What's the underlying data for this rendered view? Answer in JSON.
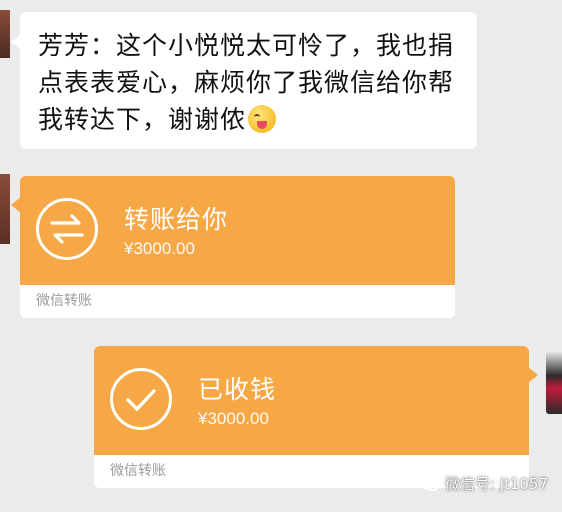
{
  "message": {
    "text": "芳芳：这个小悦悦太可怜了，我也捐点表表爱心，麻烦你了我微信给你帮我转达下，谢谢侬",
    "emoji_icon": "winking-tongue-emoji-icon"
  },
  "transfer_received": {
    "title": "转账给你",
    "amount": "¥3000.00",
    "footer": "微信转账",
    "icon": "transfer-arrows-icon",
    "color": "#f6a846"
  },
  "transfer_sent": {
    "title": "已收钱",
    "amount": "¥3000.00",
    "footer": "微信转账",
    "icon": "checkmark-icon",
    "color": "#f6a846"
  },
  "watermark": {
    "text": "微信号: jt1057",
    "icon": "wechat-logo-icon"
  }
}
